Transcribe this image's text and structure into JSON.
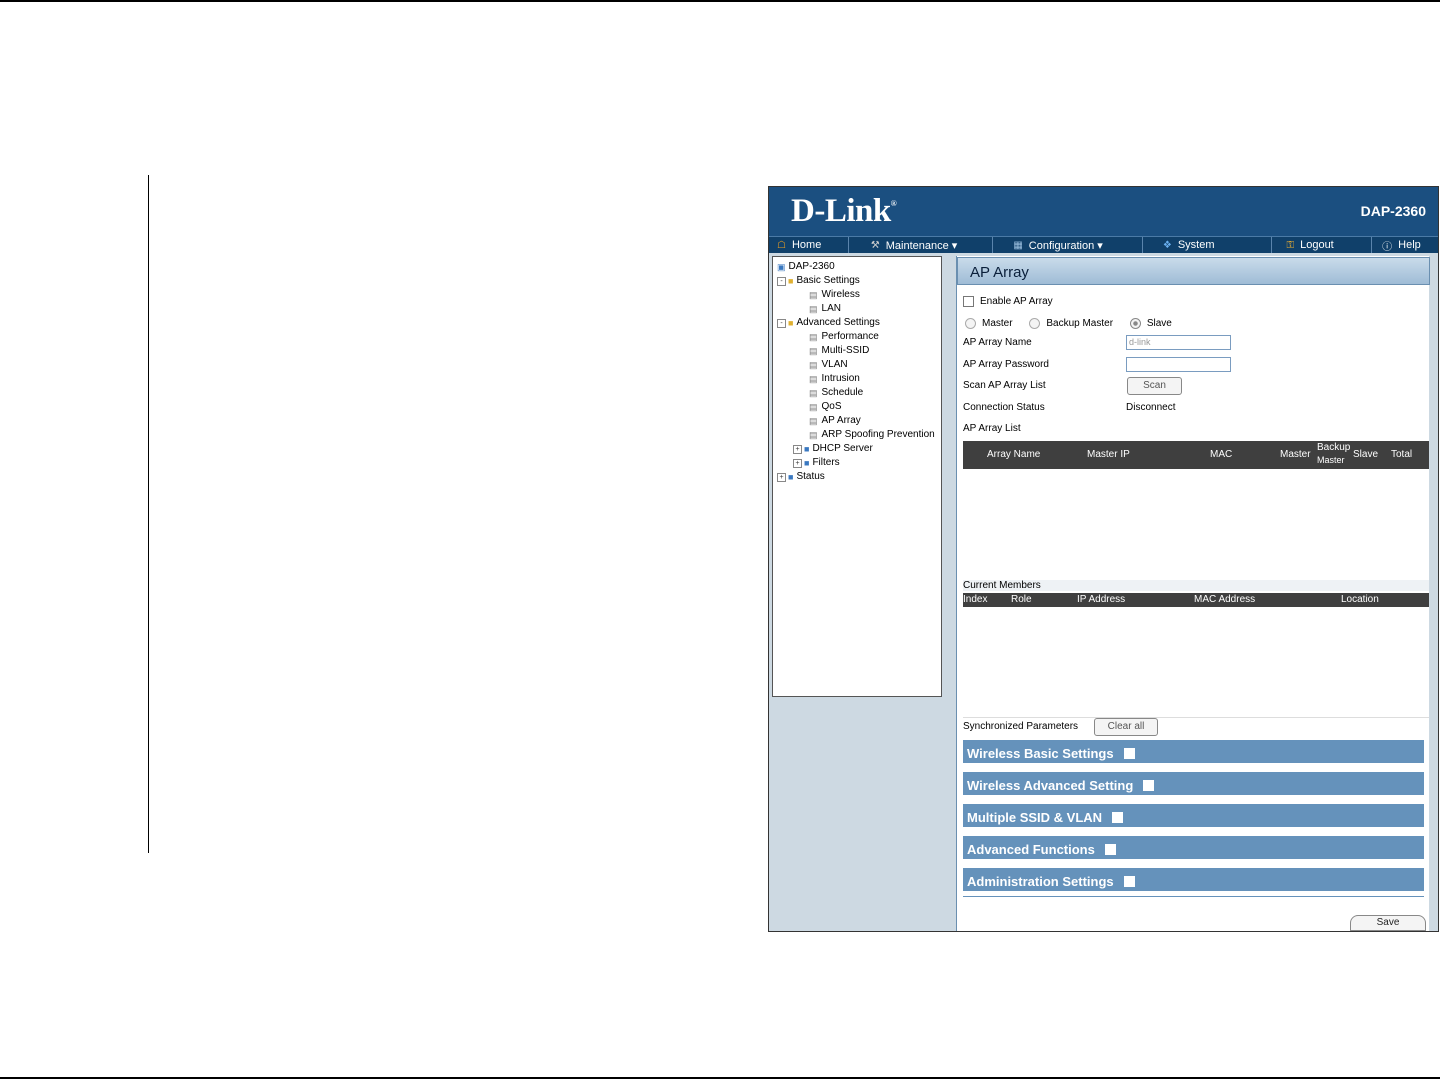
{
  "header": {
    "brand": "D-Link",
    "model": "DAP-2360"
  },
  "menu": [
    {
      "label": "Home",
      "icon": "home-icon"
    },
    {
      "label": "Maintenance ▾",
      "icon": "tools-icon"
    },
    {
      "label": "Configuration ▾",
      "icon": "floppy-icon"
    },
    {
      "label": "System",
      "icon": "system-icon"
    },
    {
      "label": "Logout",
      "icon": "key-icon"
    },
    {
      "label": "Help",
      "icon": "help-icon"
    }
  ],
  "tree": {
    "root": "DAP-2360",
    "basic": "Basic Settings",
    "wireless": "Wireless",
    "lan": "LAN",
    "advanced": "Advanced Settings",
    "performance": "Performance",
    "multissid": "Multi-SSID",
    "vlan": "VLAN",
    "intrusion": "Intrusion",
    "schedule": "Schedule",
    "qos": "QoS",
    "aparray": "AP Array",
    "arp": "ARP Spoofing Prevention",
    "dhcp": "DHCP Server",
    "filters": "Filters",
    "status": "Status"
  },
  "page": {
    "title": "AP Array",
    "enable_label": "Enable AP Array",
    "role_master": "Master",
    "role_backup": "Backup Master",
    "role_slave": "Slave",
    "name_label": "AP Array Name",
    "name_value": "d-link",
    "password_label": "AP Array Password",
    "scan_label": "Scan AP Array List",
    "scan_button": "Scan",
    "conn_label": "Connection Status",
    "conn_value": "Disconnect",
    "list_label": "AP Array List",
    "list_cols": {
      "array_name": "Array Name",
      "master_ip": "Master IP",
      "mac": "MAC",
      "master": "Master",
      "backup": "Backup",
      "backup2": "Master",
      "slave": "Slave",
      "total": "Total"
    },
    "members_label": "Current Members",
    "member_cols": {
      "index": "Index",
      "role": "Role",
      "ip": "IP Address",
      "mac": "MAC Address",
      "location": "Location"
    },
    "sync_label": "Synchronized Parameters",
    "clear_button": "Clear all",
    "sections": {
      "s1": "Wireless Basic Settings",
      "s2": "Wireless Advanced Setting",
      "s3": "Multiple SSID & VLAN",
      "s4": "Advanced Functions",
      "s5": "Administration Settings"
    },
    "save_button": "Save"
  }
}
